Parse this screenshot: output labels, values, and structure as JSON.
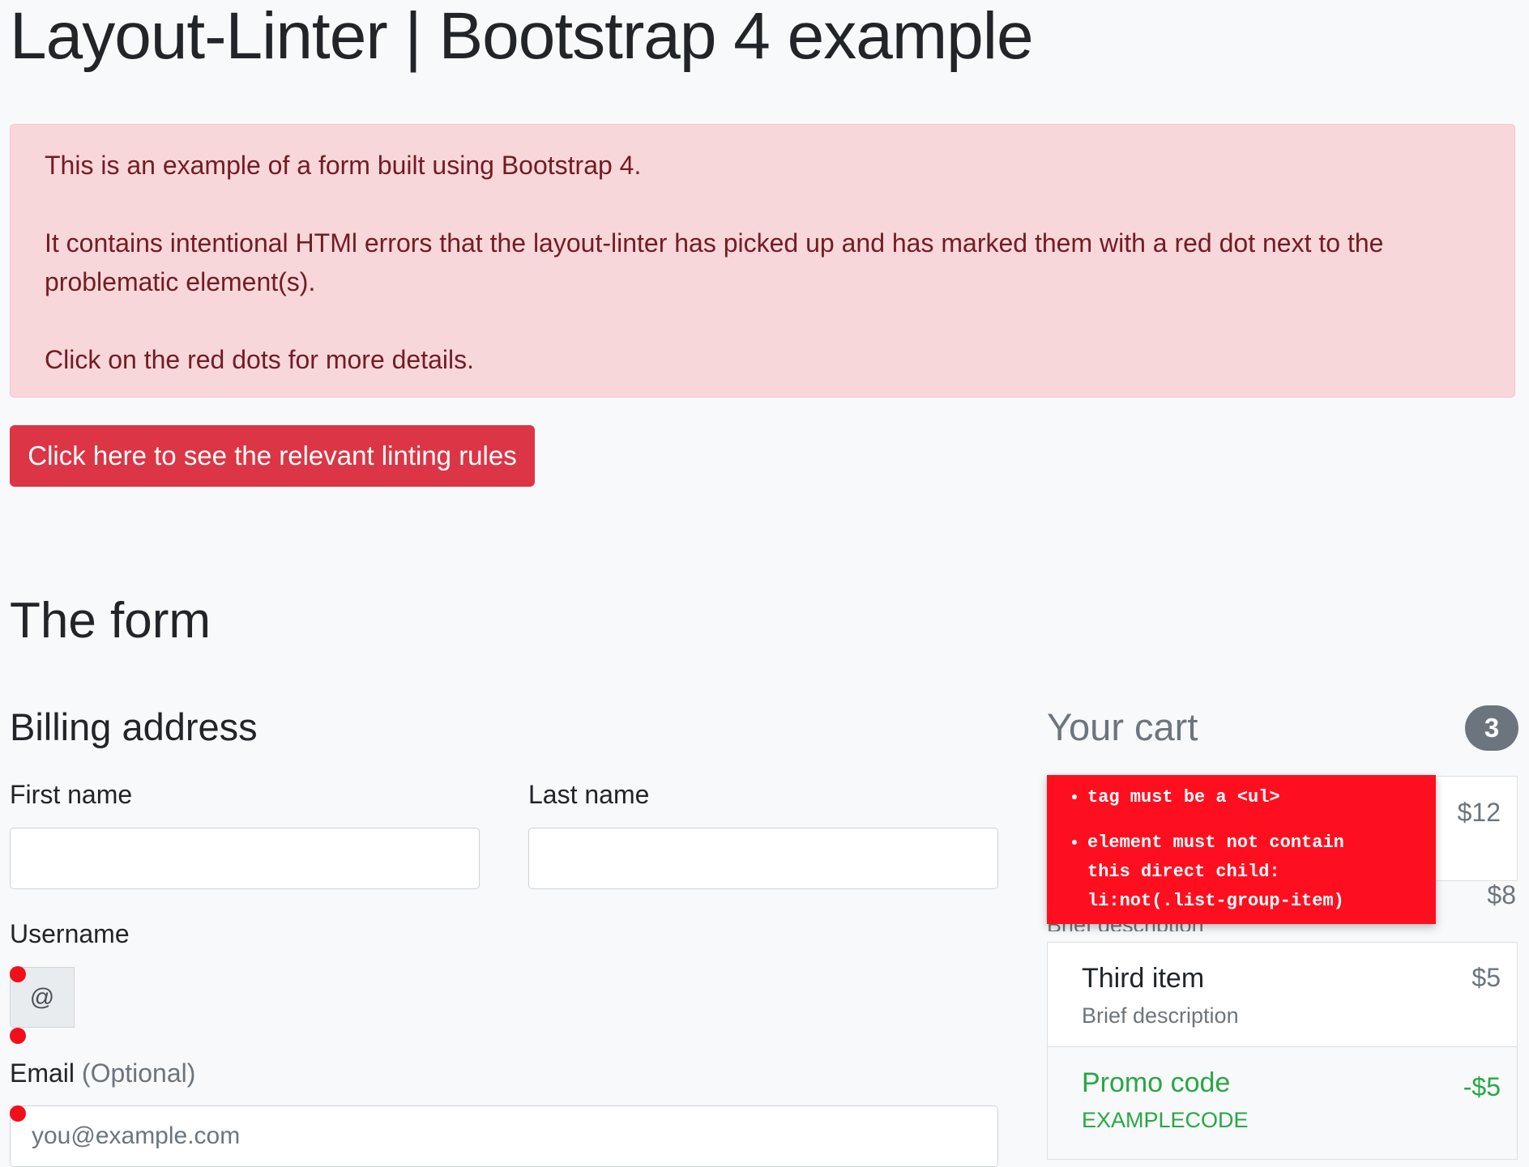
{
  "page": {
    "title": "Layout-Linter | Bootstrap 4 example"
  },
  "alert": {
    "line1": "This is an example of a form built using Bootstrap 4.",
    "line2a": "It contains intentional HTMl errors that the layout-linter has picked up and has marked them with a red dot next to the",
    "line2b": "problematic element(s).",
    "line3": "Click on the red dots for more details."
  },
  "lint_button": {
    "label": "Click here to see the relevant linting rules"
  },
  "form": {
    "heading": "The form",
    "billing_heading": "Billing address",
    "first_name_label": "First name",
    "last_name_label": "Last name",
    "username_label": "Username",
    "username_addon": "@",
    "email_label": "Email",
    "email_optional": "(Optional)",
    "email_placeholder": "you@example.com"
  },
  "cart": {
    "title": "Your cart",
    "count": "3",
    "first_price": "$12",
    "second_price": "$8",
    "second_desc_partial": "Brief description",
    "third_item": {
      "name": "Third item",
      "desc": "Brief description",
      "price": "$5"
    },
    "promo": {
      "name": "Promo code",
      "code": "EXAMPLECODE",
      "price": "-$5"
    }
  },
  "lint_popup": {
    "errors": [
      "tag must be a <ul>",
      "element must not contain this direct child: li:not(.list-group-item)"
    ],
    "error2_line1": "element must not contain",
    "error2_line2": "this direct child:",
    "error2_line3": "li:not(.list-group-item)"
  },
  "colors": {
    "alert_bg": "#f8d7da",
    "alert_text": "#721c24",
    "danger": "#dc3545",
    "lint_red": "#fe0f20",
    "success": "#28a745",
    "muted": "#6c757d"
  }
}
